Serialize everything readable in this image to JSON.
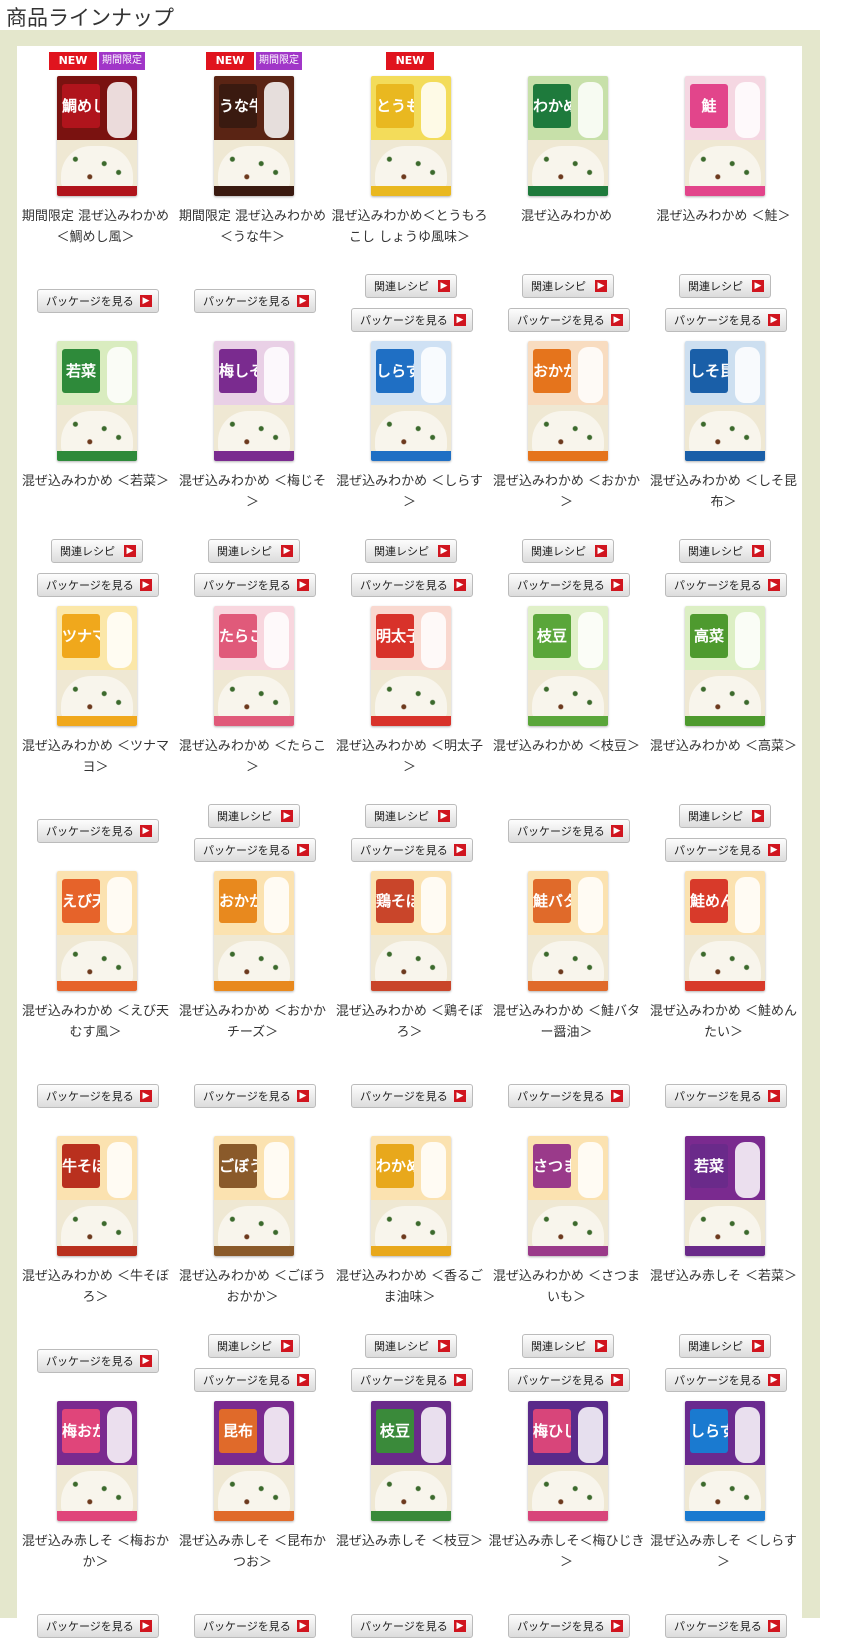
{
  "page_title": "商品ラインナップ",
  "badges": {
    "new": "NEW",
    "limited": "期間限定"
  },
  "buttons": {
    "recipe": "関連レシピ",
    "package": "パッケージを見る",
    "arrow": "▶"
  },
  "products": [
    {
      "name": "期間限定 混ぜ込みわかめ ＜鯛めし風＞",
      "label": "鯛めし",
      "color": "#b0141c",
      "bg": "#7a1210",
      "new": true,
      "limited": true,
      "recipe": false
    },
    {
      "name": "期間限定 混ぜ込みわかめ ＜うな牛＞",
      "label": "うな牛",
      "color": "#3a1a10",
      "bg": "#5a2414",
      "new": true,
      "limited": true,
      "recipe": false
    },
    {
      "name": "混ぜ込みわかめ＜とうもろこし しょうゆ風味＞",
      "label": "とうもろこし",
      "color": "#e9b820",
      "bg": "#f3dc5a",
      "new": true,
      "limited": false,
      "recipe": true
    },
    {
      "name": "混ぜ込みわかめ",
      "label": "わかめ",
      "color": "#1e7a3c",
      "bg": "#c7e0a9",
      "new": false,
      "limited": false,
      "recipe": true
    },
    {
      "name": "混ぜ込みわかめ ＜鮭＞",
      "label": "鮭",
      "color": "#e2458b",
      "bg": "#f5d7e2",
      "new": false,
      "limited": false,
      "recipe": true
    },
    {
      "name": "混ぜ込みわかめ ＜若菜＞",
      "label": "若菜",
      "color": "#2e8a3a",
      "bg": "#d9ecbf",
      "new": false,
      "limited": false,
      "recipe": true
    },
    {
      "name": "混ぜ込みわかめ ＜梅じそ＞",
      "label": "梅しそ",
      "color": "#7a2b8f",
      "bg": "#e9d0e6",
      "new": false,
      "limited": false,
      "recipe": true
    },
    {
      "name": "混ぜ込みわかめ ＜しらす＞",
      "label": "しらす",
      "color": "#1f6fc4",
      "bg": "#cfe1f4",
      "new": false,
      "limited": false,
      "recipe": true
    },
    {
      "name": "混ぜ込みわかめ ＜おかか＞",
      "label": "おかか",
      "color": "#e5741c",
      "bg": "#f8dcc0",
      "new": false,
      "limited": false,
      "recipe": true
    },
    {
      "name": "混ぜ込みわかめ ＜しそ昆布＞",
      "label": "しそ昆布",
      "color": "#1a5fa8",
      "bg": "#cddff0",
      "new": false,
      "limited": false,
      "recipe": true
    },
    {
      "name": "混ぜ込みわかめ ＜ツナマヨ＞",
      "label": "ツナマヨ",
      "color": "#f0a81c",
      "bg": "#fbe7a8",
      "new": false,
      "limited": false,
      "recipe": false
    },
    {
      "name": "混ぜ込みわかめ ＜たらこ＞",
      "label": "たらこ",
      "color": "#e05a7a",
      "bg": "#f8d6de",
      "new": false,
      "limited": false,
      "recipe": true
    },
    {
      "name": "混ぜ込みわかめ ＜明太子＞",
      "label": "明太子",
      "color": "#d8322a",
      "bg": "#f9d8cf",
      "new": false,
      "limited": false,
      "recipe": true
    },
    {
      "name": "混ぜ込みわかめ ＜枝豆＞",
      "label": "枝豆",
      "color": "#5aa63a",
      "bg": "#e0f0c8",
      "new": false,
      "limited": false,
      "recipe": false
    },
    {
      "name": "混ぜ込みわかめ ＜高菜＞",
      "label": "高菜",
      "color": "#4e9a2e",
      "bg": "#dcefc4",
      "new": false,
      "limited": false,
      "recipe": true
    },
    {
      "name": "混ぜ込みわかめ ＜えび天むす風＞",
      "label": "えび天むす",
      "color": "#e6632a",
      "bg": "#fbe2b0",
      "new": false,
      "limited": false,
      "recipe": false
    },
    {
      "name": "混ぜ込みわかめ ＜おかかチーズ＞",
      "label": "おかかチーズ",
      "color": "#e8891e",
      "bg": "#fbe2b0",
      "new": false,
      "limited": false,
      "recipe": false
    },
    {
      "name": "混ぜ込みわかめ ＜鶏そぼろ＞",
      "label": "鶏そぼろ",
      "color": "#c9452a",
      "bg": "#fbe2b0",
      "new": false,
      "limited": false,
      "recipe": false
    },
    {
      "name": "混ぜ込みわかめ ＜鮭バター醤油＞",
      "label": "鮭バター",
      "color": "#e06a2a",
      "bg": "#fbe2b0",
      "new": false,
      "limited": false,
      "recipe": false
    },
    {
      "name": "混ぜ込みわかめ ＜鮭めんたい＞",
      "label": "鮭めんたい",
      "color": "#d83a2a",
      "bg": "#fbe2b0",
      "new": false,
      "limited": false,
      "recipe": false
    },
    {
      "name": "混ぜ込みわかめ ＜牛そぼろ＞",
      "label": "牛そぼろ",
      "color": "#b9301e",
      "bg": "#fbe2b0",
      "new": false,
      "limited": false,
      "recipe": false
    },
    {
      "name": "混ぜ込みわかめ ＜ごぼうおかか＞",
      "label": "ごぼう",
      "color": "#8a5a2a",
      "bg": "#fbe2b0",
      "new": false,
      "limited": false,
      "recipe": true
    },
    {
      "name": "混ぜ込みわかめ ＜香るごま油味＞",
      "label": "わかめ",
      "color": "#e8a81c",
      "bg": "#fbe2b0",
      "new": false,
      "limited": false,
      "recipe": true
    },
    {
      "name": "混ぜ込みわかめ ＜さつまいも＞",
      "label": "さつまいも",
      "color": "#9a3a8a",
      "bg": "#fbe2b0",
      "new": false,
      "limited": false,
      "recipe": true
    },
    {
      "name": "混ぜ込み赤しそ ＜若菜＞",
      "label": "若菜",
      "color": "#6a2a8a",
      "bg": "#7a2a8f",
      "new": false,
      "limited": false,
      "recipe": true
    },
    {
      "name": "混ぜ込み赤しそ ＜梅おかか＞",
      "label": "梅おかか",
      "color": "#e0457a",
      "bg": "#7a2a8f",
      "new": false,
      "limited": false,
      "recipe": false
    },
    {
      "name": "混ぜ込み赤しそ ＜昆布かつお＞",
      "label": "昆布",
      "color": "#e06a2a",
      "bg": "#7a2a8f",
      "new": false,
      "limited": false,
      "recipe": false
    },
    {
      "name": "混ぜ込み赤しそ ＜枝豆＞",
      "label": "枝豆",
      "color": "#3a8a3a",
      "bg": "#6a2a8a",
      "new": false,
      "limited": false,
      "recipe": false
    },
    {
      "name": "混ぜ込み赤しそ＜梅ひじき＞",
      "label": "梅ひじき",
      "color": "#d8457a",
      "bg": "#5a2a8a",
      "new": false,
      "limited": false,
      "recipe": false
    },
    {
      "name": "混ぜ込み赤しそ ＜しらす＞",
      "label": "しらす",
      "color": "#1a7ad0",
      "bg": "#6a2a8f",
      "new": false,
      "limited": false,
      "recipe": false
    }
  ]
}
